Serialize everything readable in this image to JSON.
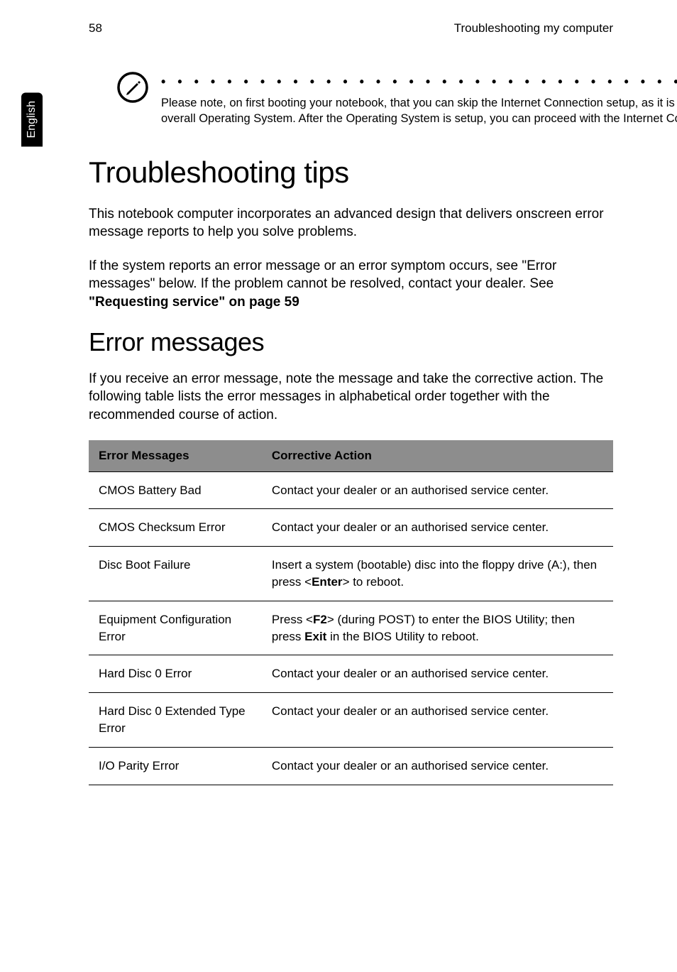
{
  "header": {
    "page_num": "58",
    "section_title": "Troubleshooting my computer"
  },
  "side_tab": "English",
  "note": {
    "dots": "• • • • • • • • • • • • • • • • • • • • • • • • • • • • • • • • • • • • • • • • • • • • • •",
    "text": "Please note, on first booting your notebook, that you can skip the Internet Connection setup, as it is not necessary to affect the installation of your overall Operating System. After the Operating System is setup, you can proceed with the Internet Connection setup."
  },
  "h1": "Troubleshooting tips",
  "para1": "This notebook computer incorporates an advanced design that delivers onscreen error message reports to help you solve problems.",
  "para2_a": "If the system reports an error message or an error symptom occurs, see \"Error messages\" below. If the problem cannot be resolved, contact your dealer. See ",
  "para2_b": "\"Requesting service\" on page 59",
  "h2": "Error messages",
  "para3": "If you receive an error message, note the message and take the corrective action. The following table lists the error messages in alphabetical order together with the recommended course of action.",
  "table": {
    "head": {
      "c1": "Error Messages",
      "c2": "Corrective Action"
    },
    "rows": [
      {
        "c1": "CMOS Battery Bad",
        "c2": "Contact your dealer or an authorised service center."
      },
      {
        "c1": "CMOS Checksum Error",
        "c2": "Contact your dealer or an authorised service center."
      },
      {
        "c1": "Disc Boot Failure",
        "c2_a": "Insert a system (bootable) disc into the floppy drive (A:), then press <",
        "c2_b": "Enter",
        "c2_c": "> to reboot."
      },
      {
        "c1": "Equipment Configuration Error",
        "c2_a": "Press <",
        "c2_b": "F2",
        "c2_c": "> (during POST) to enter the BIOS Utility; then press ",
        "c2_d": "Exit",
        "c2_e": " in the BIOS Utility to reboot."
      },
      {
        "c1": "Hard Disc 0 Error",
        "c2": "Contact your dealer or an authorised service center."
      },
      {
        "c1": "Hard Disc 0 Extended Type Error",
        "c2": "Contact your dealer or an authorised service center."
      },
      {
        "c1": "I/O Parity Error",
        "c2": "Contact your dealer or an authorised service center."
      }
    ]
  }
}
